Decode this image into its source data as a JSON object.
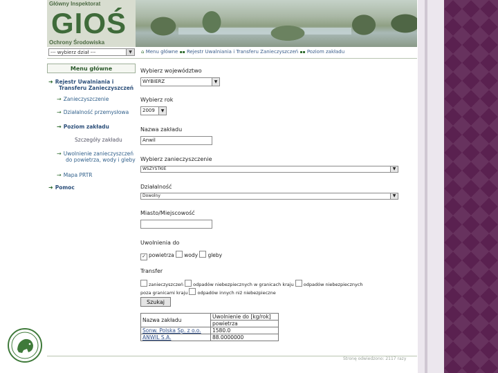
{
  "header": {
    "top_text": "Główny Inspektorat",
    "logo_text": "GIOŚ",
    "bottom_text": "Ochrony Środowiska"
  },
  "topbar": {
    "dzial_select_value": "--- wybierz dział ---",
    "breadcrumbs": [
      "Menu główne",
      "Rejestr Uwalniania i Transferu Zanieczyszczeń",
      "Poziom zakładu"
    ]
  },
  "menu": {
    "title": "Menu główne",
    "items": [
      {
        "label_line1": "Rejestr Uwalniania i",
        "label_line2": "Transferu Zanieczyszczeń"
      },
      {
        "label": "Zanieczyszczenie"
      },
      {
        "label": "Działalność przemysłowa"
      },
      {
        "label": "Poziom zakładu"
      },
      {
        "label": "Szczegóły zakładu"
      },
      {
        "label_line1": "Uwolnienie zanieczyszczeń",
        "label_line2": "do powietrza, wody i gleby"
      },
      {
        "label": "Mapa PRTR"
      },
      {
        "label": "Pomoc"
      }
    ]
  },
  "form": {
    "voivodeship_label": "Wybierz województwo",
    "voivodeship_value": "WYBIERZ",
    "year_label": "Wybierz rok",
    "year_value": "2009",
    "facility_label": "Nazwa zakładu",
    "facility_value": "Anwil",
    "pollutant_label": "Wybierz zanieczyszczenie",
    "pollutant_value": "WSZYSTKIE",
    "activity_label": "Działalność",
    "activity_value": "Dowolny",
    "city_label": "Miasto/Miejscowość",
    "city_value": "",
    "releases_label": "Uwolnienia do",
    "release_air": "powietrza",
    "release_water": "wody",
    "release_soil": "gleby",
    "transfer_label": "Transfer",
    "transfer_opt1": "zanieczyszczeń",
    "transfer_opt2": "odpadów niebezpiecznych w granicach kraju",
    "transfer_opt3": "odpadów niebezpiecznych",
    "transfer_opt3_cont": "poza granicami kraju",
    "transfer_opt4": "odpadów innych niż niebezpieczne",
    "search_button": "Szukaj"
  },
  "results": {
    "header_name": "Nazwa zakładu",
    "header_release": "Uwolnienie do [kg/rok]",
    "header_medium": "powietrza",
    "rows": [
      {
        "name": "Sonw. Polska Sp. z o.o.",
        "value": "1580.0"
      },
      {
        "name": "ANWIL S.A.",
        "value": "88.0000000"
      }
    ]
  },
  "footer": {
    "text": "Stronę odwiedzono: 2117 razy"
  }
}
